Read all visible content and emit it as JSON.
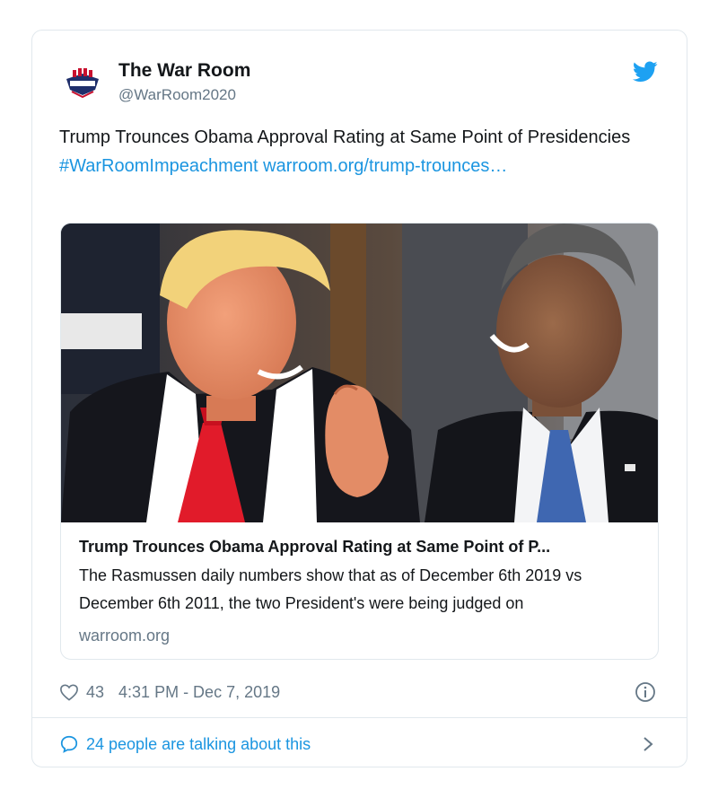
{
  "tweet": {
    "author": {
      "display_name": "The War Room",
      "handle": "@WarRoom2020",
      "avatar_icon": "war-room-logo"
    },
    "brand_icon": "twitter-bird-icon",
    "text": "Trump Trounces Obama Approval Rating at Same Point of Presidencies ",
    "hashtag": "#WarRoomImpeachment",
    "link": "warroom.org/trump-trounces…",
    "card": {
      "image_alt": "Trump and Obama smiling at each other",
      "title": "Trump Trounces Obama Approval Rating at Same Point of P...",
      "description": "The Rasmussen daily numbers show that as of December 6th 2019 vs December 6th 2011, the two President's were being judged on",
      "domain": "warroom.org"
    },
    "likes": "43",
    "timestamp": "4:31 PM - Dec 7, 2019",
    "talking": "24 people are talking about this"
  },
  "colors": {
    "link": "#1b95e0",
    "muted": "#657786",
    "border": "#e1e8ed",
    "text": "#14171a"
  }
}
